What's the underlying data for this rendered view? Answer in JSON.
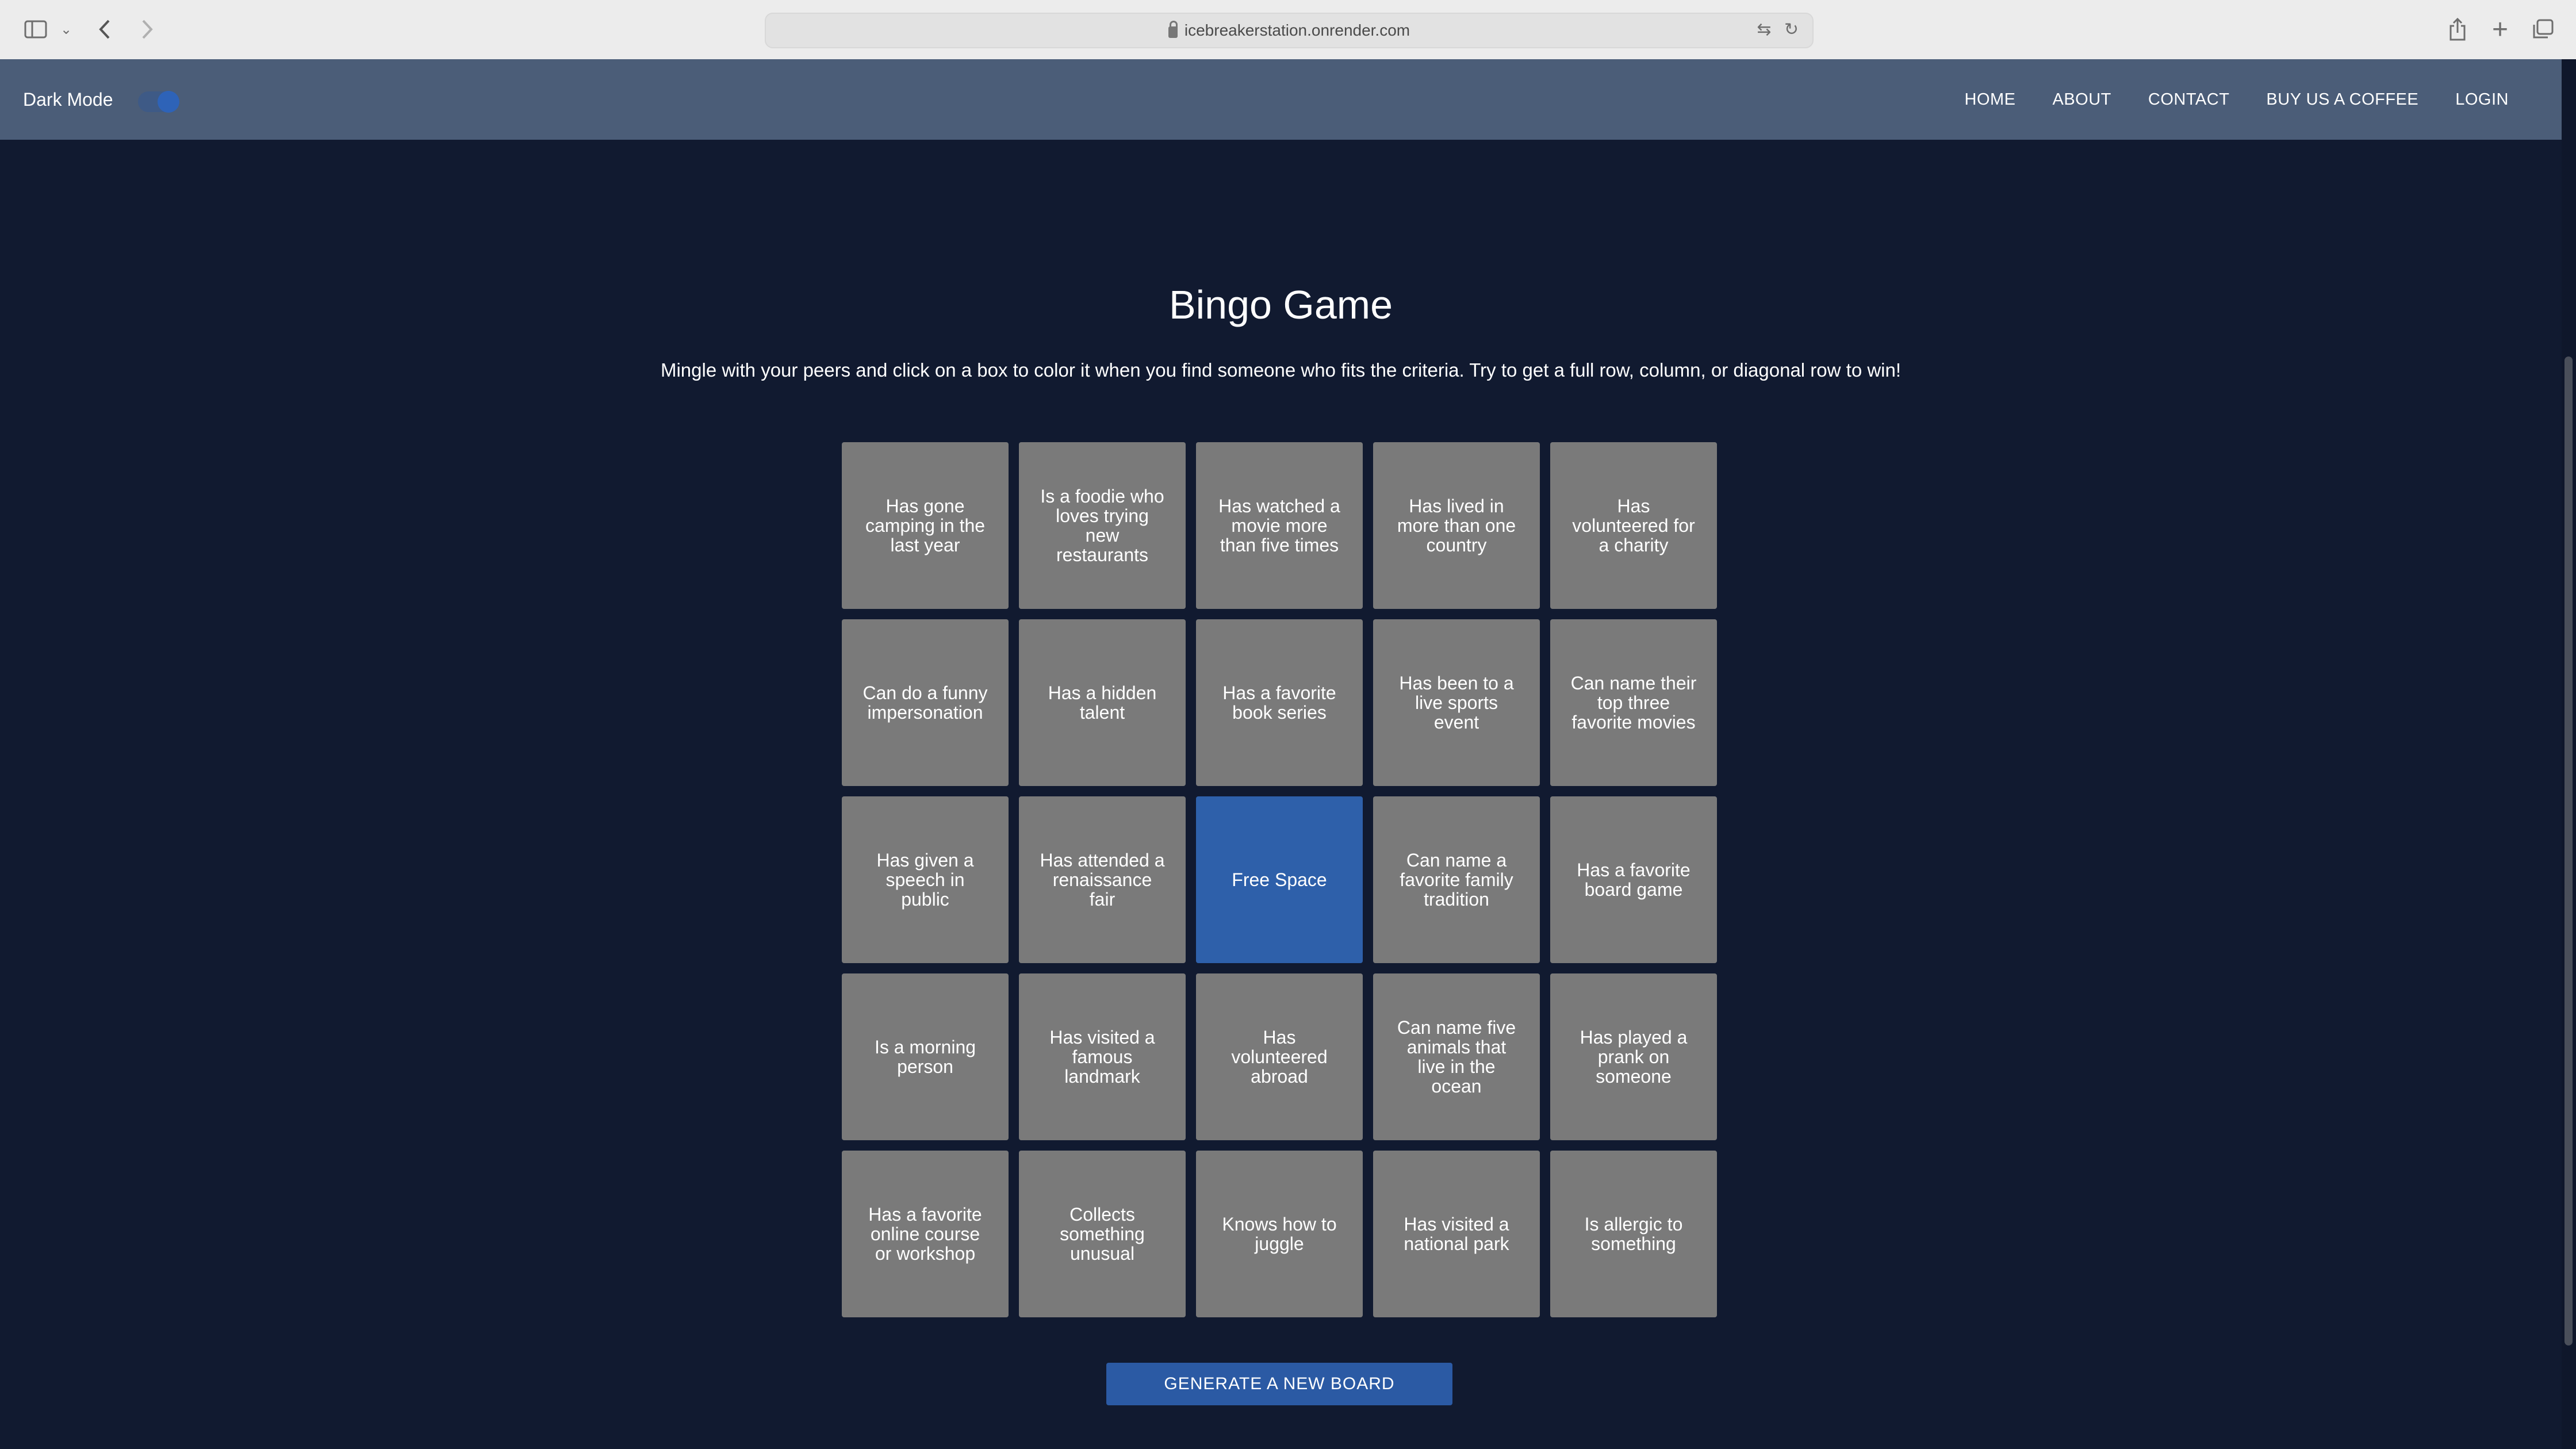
{
  "browser": {
    "url": "icebreakerstation.onrender.com",
    "icons": [
      "sidebar-icon",
      "chevron-down-icon",
      "back-icon",
      "forward-icon",
      "translate-icon",
      "reload-icon",
      "share-icon",
      "new-tab-icon",
      "tabs-overview-icon"
    ]
  },
  "nav": {
    "brand": "Dark Mode",
    "dark_mode_on": true,
    "links": [
      "HOME",
      "ABOUT",
      "CONTACT",
      "BUY US A COFFEE",
      "LOGIN"
    ]
  },
  "page": {
    "title": "Bingo Game",
    "subtitle": "Mingle with your peers and click on a box to color it when you find someone who fits the criteria. Try to get a full row, column, or diagonal row to win!"
  },
  "board": {
    "cells": [
      "Has gone camping in the last year",
      "Is a foodie who loves trying new restaurants",
      "Has watched a movie more than five times",
      "Has lived in more than one country",
      "Has volunteered for a charity",
      "Can do a funny impersonation",
      "Has a hidden talent",
      "Has a favorite book series",
      "Has been to a live sports event",
      "Can name their top three favorite movies",
      "Has given a speech in public",
      "Has attended a renaissance fair",
      "Free Space",
      "Can name a favorite family tradition",
      "Has a favorite board game",
      "Is a morning person",
      "Has visited a famous landmark",
      "Has volunteered abroad",
      "Can name five animals that live in the ocean",
      "Has played a prank on someone",
      "Has a favorite online course or workshop",
      "Collects something unusual",
      "Knows how to juggle",
      "Has visited a national park",
      "Is allergic to something"
    ],
    "marked": [
      12
    ],
    "colors": {
      "cell": "#7a7a7a",
      "marked": "#2e60aa"
    }
  },
  "actions": {
    "generate_label": "GENERATE A NEW BOARD"
  },
  "colors": {
    "background": "#111a30",
    "navbar": "#4b5d78",
    "accent": "#2b5aa4"
  }
}
